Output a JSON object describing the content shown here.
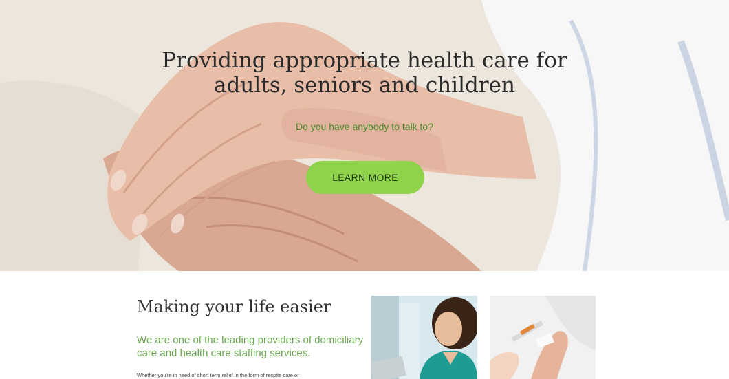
{
  "hero": {
    "title_line1": "Providing appropriate health care for",
    "title_line2": "adults, seniors and children",
    "subtitle": "Do you have anybody to talk to?",
    "cta_label": "LEARN MORE",
    "image": "holding-hands-photo"
  },
  "about": {
    "title": "Making your life easier",
    "lead": "We are one of the leading providers of domiciliary care and health care staffing services.",
    "body": "Whether you're in need of short term relief in the form of respite care or",
    "images": [
      "nurse-photo",
      "iv-drip-photo"
    ]
  },
  "colors": {
    "accent": "#8fd34a",
    "lead_text": "#6aa84f",
    "subtitle_text": "#4a8a2a"
  }
}
